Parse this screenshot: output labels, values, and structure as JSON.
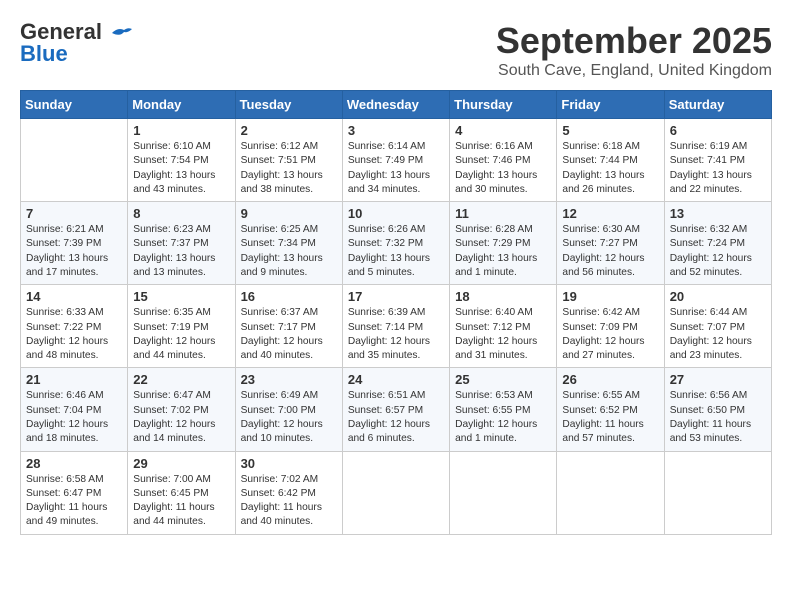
{
  "header": {
    "logo_line1": "General",
    "logo_line2": "Blue",
    "month": "September 2025",
    "location": "South Cave, England, United Kingdom"
  },
  "days_of_week": [
    "Sunday",
    "Monday",
    "Tuesday",
    "Wednesday",
    "Thursday",
    "Friday",
    "Saturday"
  ],
  "weeks": [
    [
      {
        "day": "",
        "info": ""
      },
      {
        "day": "1",
        "info": "Sunrise: 6:10 AM\nSunset: 7:54 PM\nDaylight: 13 hours\nand 43 minutes."
      },
      {
        "day": "2",
        "info": "Sunrise: 6:12 AM\nSunset: 7:51 PM\nDaylight: 13 hours\nand 38 minutes."
      },
      {
        "day": "3",
        "info": "Sunrise: 6:14 AM\nSunset: 7:49 PM\nDaylight: 13 hours\nand 34 minutes."
      },
      {
        "day": "4",
        "info": "Sunrise: 6:16 AM\nSunset: 7:46 PM\nDaylight: 13 hours\nand 30 minutes."
      },
      {
        "day": "5",
        "info": "Sunrise: 6:18 AM\nSunset: 7:44 PM\nDaylight: 13 hours\nand 26 minutes."
      },
      {
        "day": "6",
        "info": "Sunrise: 6:19 AM\nSunset: 7:41 PM\nDaylight: 13 hours\nand 22 minutes."
      }
    ],
    [
      {
        "day": "7",
        "info": "Sunrise: 6:21 AM\nSunset: 7:39 PM\nDaylight: 13 hours\nand 17 minutes."
      },
      {
        "day": "8",
        "info": "Sunrise: 6:23 AM\nSunset: 7:37 PM\nDaylight: 13 hours\nand 13 minutes."
      },
      {
        "day": "9",
        "info": "Sunrise: 6:25 AM\nSunset: 7:34 PM\nDaylight: 13 hours\nand 9 minutes."
      },
      {
        "day": "10",
        "info": "Sunrise: 6:26 AM\nSunset: 7:32 PM\nDaylight: 13 hours\nand 5 minutes."
      },
      {
        "day": "11",
        "info": "Sunrise: 6:28 AM\nSunset: 7:29 PM\nDaylight: 13 hours\nand 1 minute."
      },
      {
        "day": "12",
        "info": "Sunrise: 6:30 AM\nSunset: 7:27 PM\nDaylight: 12 hours\nand 56 minutes."
      },
      {
        "day": "13",
        "info": "Sunrise: 6:32 AM\nSunset: 7:24 PM\nDaylight: 12 hours\nand 52 minutes."
      }
    ],
    [
      {
        "day": "14",
        "info": "Sunrise: 6:33 AM\nSunset: 7:22 PM\nDaylight: 12 hours\nand 48 minutes."
      },
      {
        "day": "15",
        "info": "Sunrise: 6:35 AM\nSunset: 7:19 PM\nDaylight: 12 hours\nand 44 minutes."
      },
      {
        "day": "16",
        "info": "Sunrise: 6:37 AM\nSunset: 7:17 PM\nDaylight: 12 hours\nand 40 minutes."
      },
      {
        "day": "17",
        "info": "Sunrise: 6:39 AM\nSunset: 7:14 PM\nDaylight: 12 hours\nand 35 minutes."
      },
      {
        "day": "18",
        "info": "Sunrise: 6:40 AM\nSunset: 7:12 PM\nDaylight: 12 hours\nand 31 minutes."
      },
      {
        "day": "19",
        "info": "Sunrise: 6:42 AM\nSunset: 7:09 PM\nDaylight: 12 hours\nand 27 minutes."
      },
      {
        "day": "20",
        "info": "Sunrise: 6:44 AM\nSunset: 7:07 PM\nDaylight: 12 hours\nand 23 minutes."
      }
    ],
    [
      {
        "day": "21",
        "info": "Sunrise: 6:46 AM\nSunset: 7:04 PM\nDaylight: 12 hours\nand 18 minutes."
      },
      {
        "day": "22",
        "info": "Sunrise: 6:47 AM\nSunset: 7:02 PM\nDaylight: 12 hours\nand 14 minutes."
      },
      {
        "day": "23",
        "info": "Sunrise: 6:49 AM\nSunset: 7:00 PM\nDaylight: 12 hours\nand 10 minutes."
      },
      {
        "day": "24",
        "info": "Sunrise: 6:51 AM\nSunset: 6:57 PM\nDaylight: 12 hours\nand 6 minutes."
      },
      {
        "day": "25",
        "info": "Sunrise: 6:53 AM\nSunset: 6:55 PM\nDaylight: 12 hours\nand 1 minute."
      },
      {
        "day": "26",
        "info": "Sunrise: 6:55 AM\nSunset: 6:52 PM\nDaylight: 11 hours\nand 57 minutes."
      },
      {
        "day": "27",
        "info": "Sunrise: 6:56 AM\nSunset: 6:50 PM\nDaylight: 11 hours\nand 53 minutes."
      }
    ],
    [
      {
        "day": "28",
        "info": "Sunrise: 6:58 AM\nSunset: 6:47 PM\nDaylight: 11 hours\nand 49 minutes."
      },
      {
        "day": "29",
        "info": "Sunrise: 7:00 AM\nSunset: 6:45 PM\nDaylight: 11 hours\nand 44 minutes."
      },
      {
        "day": "30",
        "info": "Sunrise: 7:02 AM\nSunset: 6:42 PM\nDaylight: 11 hours\nand 40 minutes."
      },
      {
        "day": "",
        "info": ""
      },
      {
        "day": "",
        "info": ""
      },
      {
        "day": "",
        "info": ""
      },
      {
        "day": "",
        "info": ""
      }
    ]
  ]
}
